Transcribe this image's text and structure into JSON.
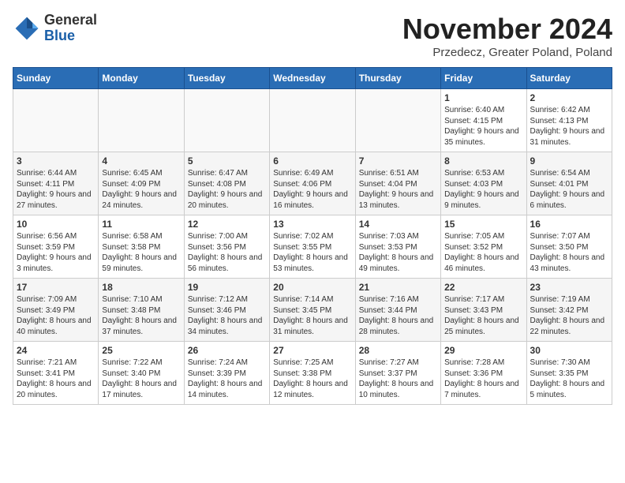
{
  "header": {
    "logo_general": "General",
    "logo_blue": "Blue",
    "month_title": "November 2024",
    "subtitle": "Przedecz, Greater Poland, Poland"
  },
  "calendar": {
    "days_of_week": [
      "Sunday",
      "Monday",
      "Tuesday",
      "Wednesday",
      "Thursday",
      "Friday",
      "Saturday"
    ],
    "weeks": [
      [
        {
          "day": "",
          "info": ""
        },
        {
          "day": "",
          "info": ""
        },
        {
          "day": "",
          "info": ""
        },
        {
          "day": "",
          "info": ""
        },
        {
          "day": "",
          "info": ""
        },
        {
          "day": "1",
          "info": "Sunrise: 6:40 AM\nSunset: 4:15 PM\nDaylight: 9 hours and 35 minutes."
        },
        {
          "day": "2",
          "info": "Sunrise: 6:42 AM\nSunset: 4:13 PM\nDaylight: 9 hours and 31 minutes."
        }
      ],
      [
        {
          "day": "3",
          "info": "Sunrise: 6:44 AM\nSunset: 4:11 PM\nDaylight: 9 hours and 27 minutes."
        },
        {
          "day": "4",
          "info": "Sunrise: 6:45 AM\nSunset: 4:09 PM\nDaylight: 9 hours and 24 minutes."
        },
        {
          "day": "5",
          "info": "Sunrise: 6:47 AM\nSunset: 4:08 PM\nDaylight: 9 hours and 20 minutes."
        },
        {
          "day": "6",
          "info": "Sunrise: 6:49 AM\nSunset: 4:06 PM\nDaylight: 9 hours and 16 minutes."
        },
        {
          "day": "7",
          "info": "Sunrise: 6:51 AM\nSunset: 4:04 PM\nDaylight: 9 hours and 13 minutes."
        },
        {
          "day": "8",
          "info": "Sunrise: 6:53 AM\nSunset: 4:03 PM\nDaylight: 9 hours and 9 minutes."
        },
        {
          "day": "9",
          "info": "Sunrise: 6:54 AM\nSunset: 4:01 PM\nDaylight: 9 hours and 6 minutes."
        }
      ],
      [
        {
          "day": "10",
          "info": "Sunrise: 6:56 AM\nSunset: 3:59 PM\nDaylight: 9 hours and 3 minutes."
        },
        {
          "day": "11",
          "info": "Sunrise: 6:58 AM\nSunset: 3:58 PM\nDaylight: 8 hours and 59 minutes."
        },
        {
          "day": "12",
          "info": "Sunrise: 7:00 AM\nSunset: 3:56 PM\nDaylight: 8 hours and 56 minutes."
        },
        {
          "day": "13",
          "info": "Sunrise: 7:02 AM\nSunset: 3:55 PM\nDaylight: 8 hours and 53 minutes."
        },
        {
          "day": "14",
          "info": "Sunrise: 7:03 AM\nSunset: 3:53 PM\nDaylight: 8 hours and 49 minutes."
        },
        {
          "day": "15",
          "info": "Sunrise: 7:05 AM\nSunset: 3:52 PM\nDaylight: 8 hours and 46 minutes."
        },
        {
          "day": "16",
          "info": "Sunrise: 7:07 AM\nSunset: 3:50 PM\nDaylight: 8 hours and 43 minutes."
        }
      ],
      [
        {
          "day": "17",
          "info": "Sunrise: 7:09 AM\nSunset: 3:49 PM\nDaylight: 8 hours and 40 minutes."
        },
        {
          "day": "18",
          "info": "Sunrise: 7:10 AM\nSunset: 3:48 PM\nDaylight: 8 hours and 37 minutes."
        },
        {
          "day": "19",
          "info": "Sunrise: 7:12 AM\nSunset: 3:46 PM\nDaylight: 8 hours and 34 minutes."
        },
        {
          "day": "20",
          "info": "Sunrise: 7:14 AM\nSunset: 3:45 PM\nDaylight: 8 hours and 31 minutes."
        },
        {
          "day": "21",
          "info": "Sunrise: 7:16 AM\nSunset: 3:44 PM\nDaylight: 8 hours and 28 minutes."
        },
        {
          "day": "22",
          "info": "Sunrise: 7:17 AM\nSunset: 3:43 PM\nDaylight: 8 hours and 25 minutes."
        },
        {
          "day": "23",
          "info": "Sunrise: 7:19 AM\nSunset: 3:42 PM\nDaylight: 8 hours and 22 minutes."
        }
      ],
      [
        {
          "day": "24",
          "info": "Sunrise: 7:21 AM\nSunset: 3:41 PM\nDaylight: 8 hours and 20 minutes."
        },
        {
          "day": "25",
          "info": "Sunrise: 7:22 AM\nSunset: 3:40 PM\nDaylight: 8 hours and 17 minutes."
        },
        {
          "day": "26",
          "info": "Sunrise: 7:24 AM\nSunset: 3:39 PM\nDaylight: 8 hours and 14 minutes."
        },
        {
          "day": "27",
          "info": "Sunrise: 7:25 AM\nSunset: 3:38 PM\nDaylight: 8 hours and 12 minutes."
        },
        {
          "day": "28",
          "info": "Sunrise: 7:27 AM\nSunset: 3:37 PM\nDaylight: 8 hours and 10 minutes."
        },
        {
          "day": "29",
          "info": "Sunrise: 7:28 AM\nSunset: 3:36 PM\nDaylight: 8 hours and 7 minutes."
        },
        {
          "day": "30",
          "info": "Sunrise: 7:30 AM\nSunset: 3:35 PM\nDaylight: 8 hours and 5 minutes."
        }
      ]
    ]
  }
}
